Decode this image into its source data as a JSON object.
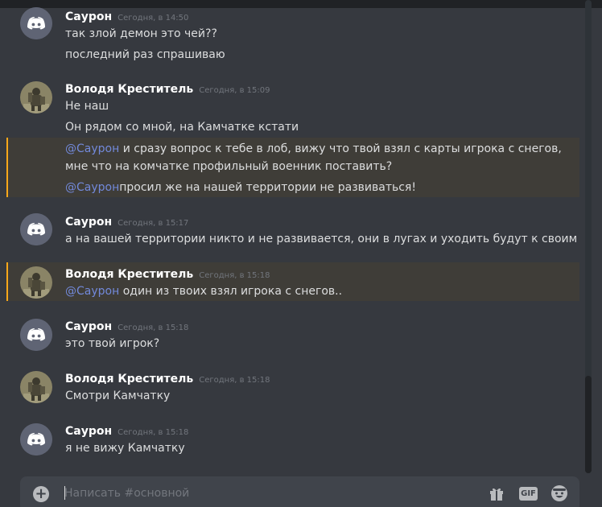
{
  "composer": {
    "placeholder": "Написать #основной",
    "gif_label": "GIF",
    "add_label": "+"
  },
  "messages": [
    {
      "author": "Саурон",
      "time": "Сегодня, в 14:50",
      "lines": [
        "так злой демон это чей??",
        "последний раз спрашиваю"
      ]
    },
    {
      "author": "Володя Креститель",
      "time": "Сегодня, в 15:09",
      "lines": [
        "Не наш",
        "Он рядом со мной, на Камчатке кстати"
      ],
      "mention_lines": [
        {
          "ping": "@Саурон",
          "text": " и сразу вопрос к тебе в лоб, вижу что твой взял с карты игрока с снегов,"
        },
        {
          "ping": "",
          "text": "мне что на комчатке профильный военник поставить?"
        },
        {
          "ping": "@Саурон",
          "text": "просил же на нашей территории не развиваться!"
        }
      ]
    },
    {
      "author": "Саурон",
      "time": "Сегодня, в 15:17",
      "lines": [
        "а на вашей территории никто и не развивается, они в лугах и уходить будут к своим"
      ]
    },
    {
      "author": "Володя Креститель",
      "time": "Сегодня, в 15:18",
      "mention_lines": [
        {
          "ping": "@Саурон",
          "text": " один из твоих взял игрока с снегов.."
        }
      ]
    },
    {
      "author": "Саурон",
      "time": "Сегодня, в 15:18",
      "lines": [
        "это твой игрок?"
      ]
    },
    {
      "author": "Володя Креститель",
      "time": "Сегодня, в 15:18",
      "lines": [
        "Смотри Камчатку"
      ]
    },
    {
      "author": "Саурон",
      "time": "Сегодня, в 15:18",
      "lines": [
        "я не вижу Камчатку"
      ]
    }
  ],
  "colors": {
    "background": "#36393f",
    "mention_accent": "#faa81a",
    "ping": "#7289da"
  }
}
